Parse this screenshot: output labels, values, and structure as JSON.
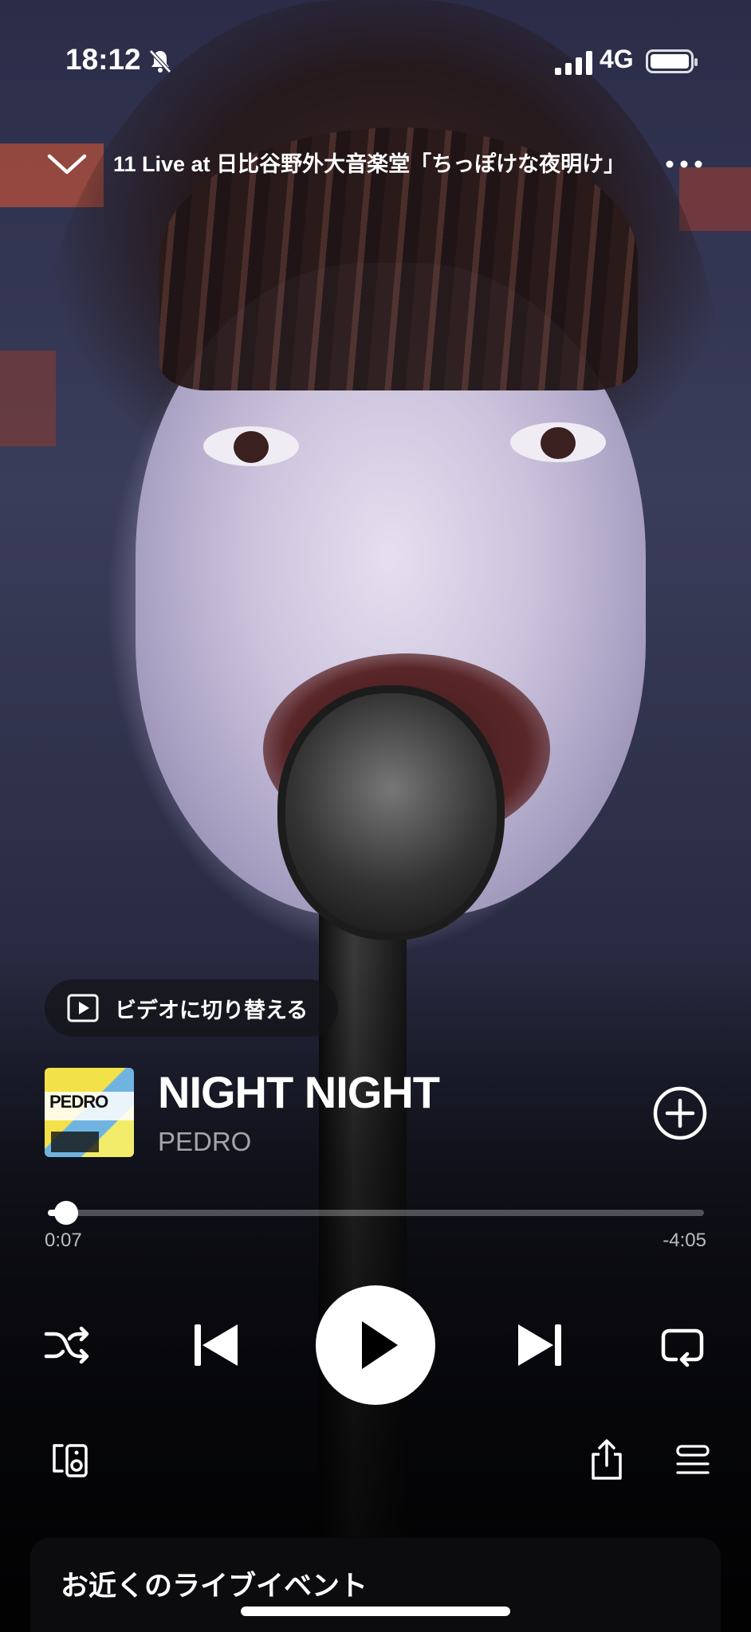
{
  "status_bar": {
    "time": "18:12",
    "network": "4G",
    "icons": [
      "bell-slash-icon",
      "cellular-signal-icon",
      "battery-icon"
    ]
  },
  "nav": {
    "context_title": "11 Live at 日比谷野外大音楽堂「ちっぽけな夜明け」",
    "icons": [
      "chevron-down-icon",
      "more-options-icon"
    ]
  },
  "switch_to_video": {
    "label": "ビデオに切り替える",
    "icon": "video-play-icon"
  },
  "track": {
    "title": "NIGHT NIGHT",
    "artist": "PEDRO",
    "artwork_text": "PEDRO"
  },
  "playback": {
    "elapsed": "0:07",
    "remaining": "-4:05",
    "progress_fraction": 0.0276,
    "state": "paused"
  },
  "controls": {
    "icons": [
      "shuffle-icon",
      "previous-track-icon",
      "play-icon",
      "next-track-icon",
      "repeat-icon"
    ]
  },
  "bottom_actions": {
    "icons": [
      "connect-devices-icon",
      "share-icon",
      "queue-icon"
    ]
  },
  "live_events": {
    "heading": "お近くのライブイベント"
  },
  "colors": {
    "accent": "#ffffff",
    "secondary_text": "#a3a3a3",
    "card_bg": "#0c0c0e"
  }
}
